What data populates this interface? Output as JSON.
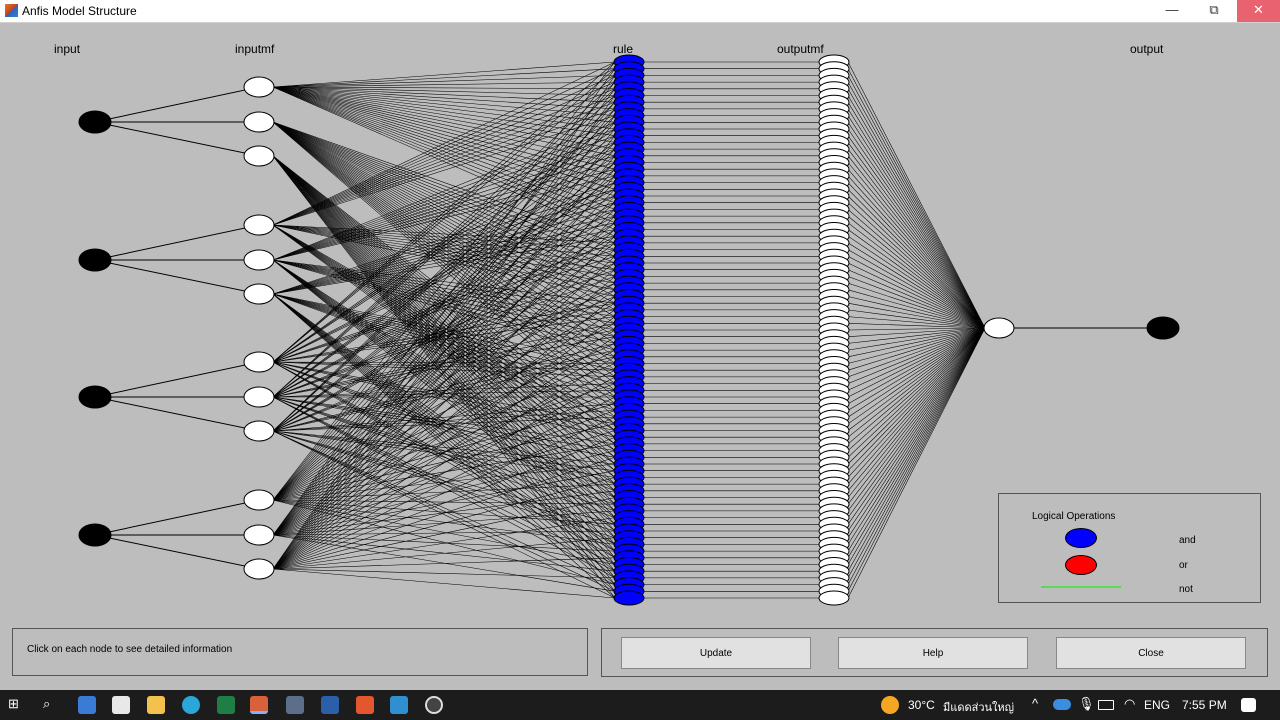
{
  "window": {
    "title": "Anfis Model Structure",
    "minimize": "—",
    "maximize": "⧉",
    "close": "✕"
  },
  "columns": {
    "input": "input",
    "inputmf": "inputmf",
    "rule": "rule",
    "outputmf": "outputmf",
    "output": "output"
  },
  "network": {
    "inputs": 4,
    "mfs_per_input": 3,
    "rules": 81,
    "outputmfs": 81,
    "outputs": 1,
    "colors": {
      "background": "#bdbdbd",
      "input_node": "#000000",
      "mf_node": "#ffffff",
      "rule_node": "#0000ff",
      "edge": "#000000"
    }
  },
  "legend": {
    "title": "Logical Operations",
    "and_label": "and",
    "or_label": "or",
    "not_label": "not",
    "and_color": "#0000ff",
    "or_color": "#ff0000",
    "not_color": "#55dd55"
  },
  "info": {
    "text": "Click on each node to see detailed information"
  },
  "buttons": {
    "update": "Update",
    "help": "Help",
    "close": "Close"
  },
  "taskbar": {
    "weather": "30°C",
    "weather_desc": "มีแดดส่วนใหญ่",
    "language": "ENG",
    "time": "7:55 PM"
  }
}
